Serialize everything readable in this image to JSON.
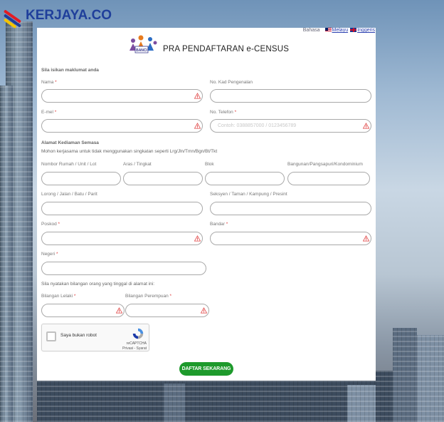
{
  "site": {
    "logo_text": "KERJAYA.CO"
  },
  "lang": {
    "label": "Bahasa",
    "malay": "Melayu",
    "english": "Inggeris"
  },
  "header": {
    "title": "PRA PENDAFTARAN e-CENSUS",
    "logo_text": "BANCI"
  },
  "form": {
    "intro": "Sila isikan maklumat anda",
    "nama_label": "Nama",
    "ic_label": "No. Kad Pengenalan",
    "email_label": "E-mel",
    "phone_label": "No. Telefon",
    "phone_placeholder": "Contoh: 0388857000 / 0123456789",
    "address_section": "Alamat Kediaman Semasa",
    "address_note": "Mohon kerjasama untuk tidak menggunakan singkatan seperti Lrg/Jln/Tmn/Bgn/Bt/Tkt",
    "house_label": "Nombor Rumah / Unit / Lot",
    "floor_label": "Aras / Tingkat",
    "block_label": "Blok",
    "building_label": "Bangunan/Pangsapuri/Kondominium",
    "street_label": "Lorong / Jalan / Batu / Parit",
    "section_label": "Seksyen / Taman / Kampung / Presint",
    "postcode_label": "Poskod",
    "city_label": "Bandar",
    "state_label": "Negeri",
    "household_note": "Sila nyatakan bilangan orang yang tinggal di alamat ini:",
    "male_label": "Bilangan Lelaki",
    "female_label": "Bilangan Perempuan",
    "required_mark": "*",
    "submit_label": "DAFTAR SEKARANG"
  },
  "recaptcha": {
    "label": "Saya bukan robot",
    "brand": "reCAPTCHA",
    "links": "Privasi - Syarat"
  },
  "colors": {
    "accent": "#1e9a2c",
    "warning": "#e04040",
    "logo_blue": "#1f3f9b"
  }
}
